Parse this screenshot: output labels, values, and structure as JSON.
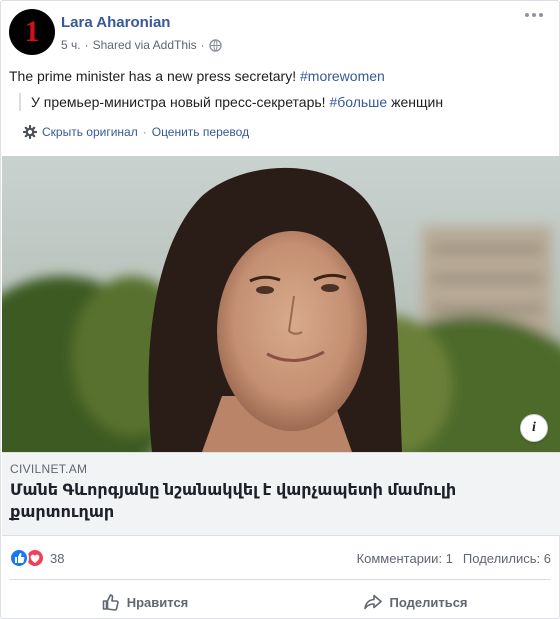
{
  "post": {
    "author": "Lara Aharonian",
    "avatar_text": "1",
    "time": "5 ч.",
    "separator": "·",
    "shared_via": "Shared via AddThis",
    "text_main": "The prime minister has a new press secretary! ",
    "text_hashtag": "#morewomen",
    "translation_before": "У премьер-министра новый пресс-секретарь! ",
    "translation_hashtag": "#больше",
    "translation_after": " женщин",
    "show_original": "Скрыть оригинал",
    "rate_translation": "Оценить перевод",
    "more_icon": "more-dots-icon",
    "privacy_icon": "globe-icon"
  },
  "link": {
    "domain": "CIVILNET.AM",
    "title": "Մանե Գևորգյանը նշանակվել է վարչապետի մամուլի քարտուղար",
    "info_label": "i"
  },
  "stats": {
    "reactions_count": "38",
    "comments": "Комментарии: 1",
    "shares": "Поделились: 6"
  },
  "actions": {
    "like": "Нравится",
    "share": "Поделиться"
  },
  "colors": {
    "link_blue": "#385898",
    "like_blue": "#1877f2",
    "love_red": "#f33e58",
    "avatar_red": "#d0101b"
  }
}
